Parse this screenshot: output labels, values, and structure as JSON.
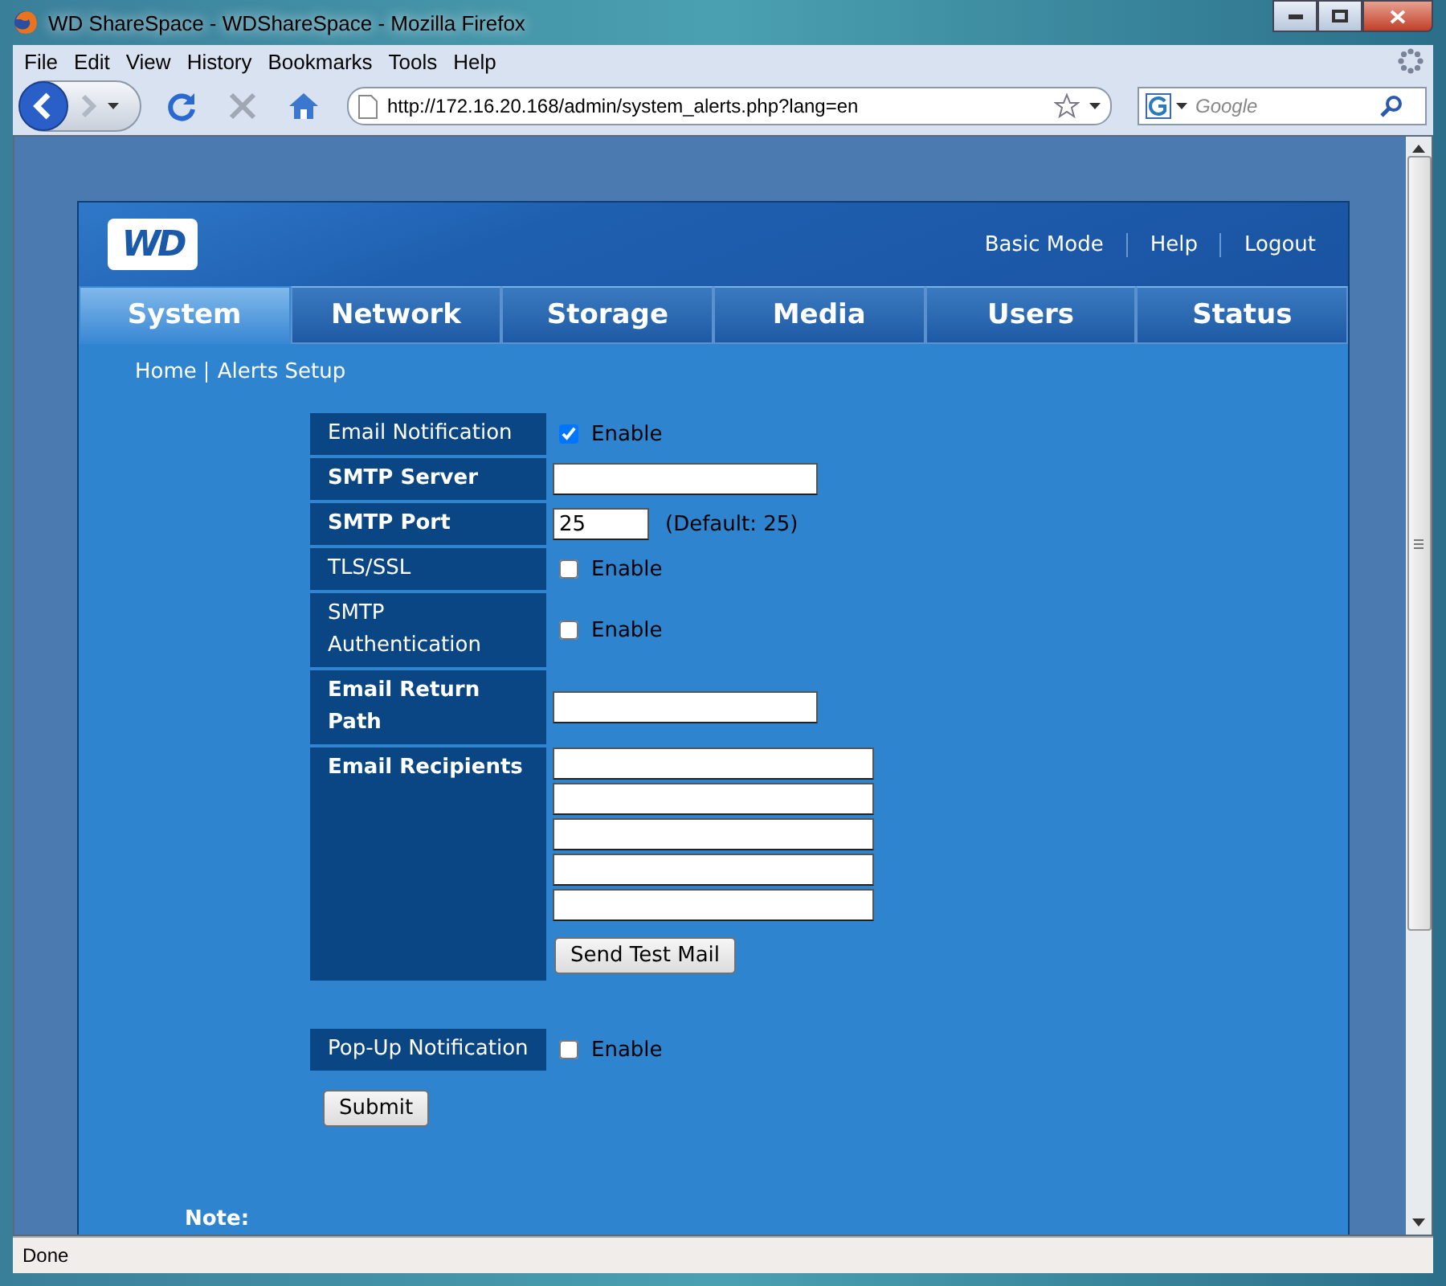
{
  "window": {
    "title": "WD ShareSpace - WDShareSpace - Mozilla Firefox"
  },
  "menu": [
    "File",
    "Edit",
    "View",
    "History",
    "Bookmarks",
    "Tools",
    "Help"
  ],
  "toolbar": {
    "url": "http://172.16.20.168/admin/system_alerts.php?lang=en",
    "search_placeholder": "Google"
  },
  "header": {
    "logo": "WD",
    "links": [
      "Basic Mode",
      "Help",
      "Logout"
    ]
  },
  "tabs": [
    {
      "label": "System",
      "selected": true
    },
    {
      "label": "Network",
      "selected": false
    },
    {
      "label": "Storage",
      "selected": false
    },
    {
      "label": "Media",
      "selected": false
    },
    {
      "label": "Users",
      "selected": false
    },
    {
      "label": "Status",
      "selected": false
    }
  ],
  "breadcrumb": [
    "Home",
    "Alerts Setup"
  ],
  "form": [
    {
      "kind": "checkbox",
      "label": "Email Notification",
      "checked": true,
      "option": "Enable"
    },
    {
      "kind": "text",
      "label": "SMTP Server"
    },
    {
      "kind": "port",
      "label": "SMTP Port",
      "value": "25",
      "hint": "(Default: 25)"
    },
    {
      "kind": "checkbox",
      "label": "TLS/SSL",
      "checked": false,
      "option": "Enable"
    },
    {
      "kind": "checkbox",
      "label": "SMTP Authentication",
      "checked": false,
      "option": "Enable"
    },
    {
      "kind": "text",
      "label": "Email Return Path"
    },
    {
      "kind": "recipients",
      "label": "Email Recipients",
      "fields": [
        {
          "kind": "text"
        },
        {
          "kind": "text"
        },
        {
          "kind": "text"
        },
        {
          "kind": "text"
        },
        {
          "kind": "text"
        }
      ],
      "button": "Send Test Mail"
    }
  ],
  "popup": {
    "label": "Pop-Up Notification",
    "checked": false,
    "option": "Enable"
  },
  "submit": "Submit",
  "note": "Note:",
  "status_bar": "Done"
}
